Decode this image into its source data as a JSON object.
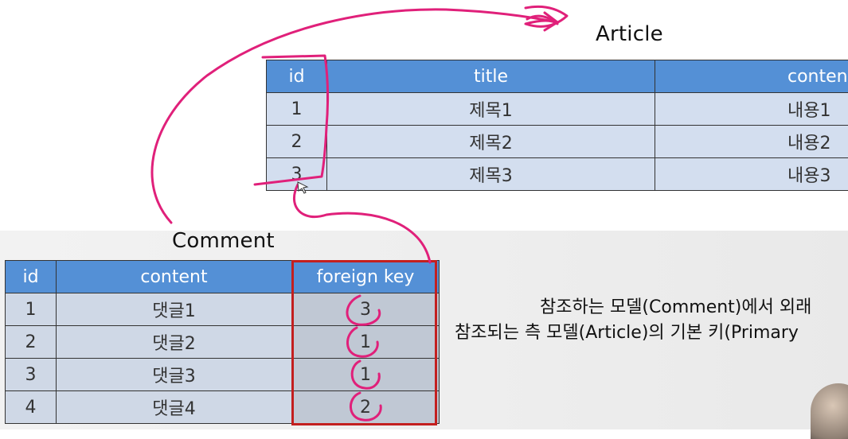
{
  "article": {
    "title": "Article",
    "headers": [
      "id",
      "title",
      "content"
    ],
    "rows": [
      [
        "1",
        "제목1",
        "내용1"
      ],
      [
        "2",
        "제목2",
        "내용2"
      ],
      [
        "3",
        "제목3",
        "내용3"
      ]
    ]
  },
  "comment": {
    "title": "Comment",
    "headers": [
      "id",
      "content",
      "foreign key"
    ],
    "rows": [
      [
        "1",
        "댓글1",
        "3"
      ],
      [
        "2",
        "댓글2",
        "1"
      ],
      [
        "3",
        "댓글3",
        "1"
      ],
      [
        "4",
        "댓글4",
        "2"
      ]
    ]
  },
  "caption": {
    "line1": "참조하는 모델(Comment)에서 외래",
    "line2": "참조되는 측 모델(Article)의 기본 키(Primary"
  },
  "colors": {
    "header": "#5490d6",
    "annotation": "#e0207a",
    "fk_border": "#c31f1f"
  }
}
